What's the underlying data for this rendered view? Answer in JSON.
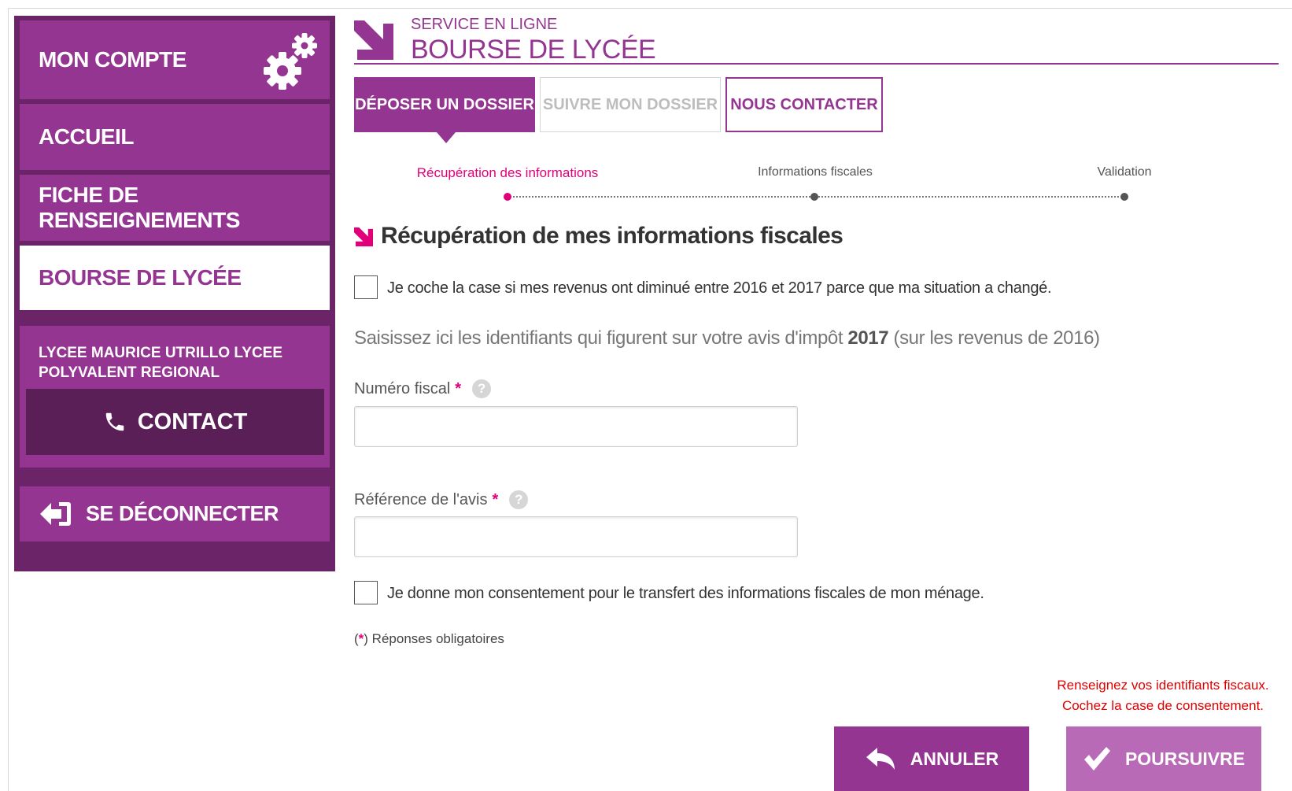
{
  "colors": {
    "brand_purple": "#943592",
    "brand_purple_dark": "#6b2468",
    "accent_pink": "#e2007a",
    "error_red": "#e00000",
    "poursuivre_disabled": "#b96ab7"
  },
  "sidebar": {
    "mon_compte": "MON COMPTE",
    "accueil": "ACCUEIL",
    "fiche": "FICHE DE RENSEIGNEMENTS",
    "bourse": "BOURSE DE LYCÉE",
    "school": "LYCEE MAURICE UTRILLO LYCEE POLYVALENT REGIONAL",
    "contact": "CONTACT",
    "logout": "SE DÉCONNECTER",
    "icons": [
      "gears-icon",
      "phone-icon",
      "logout-icon"
    ]
  },
  "header": {
    "subtitle": "SERVICE EN LIGNE",
    "title": "BOURSE DE LYCÉE"
  },
  "tabs": [
    {
      "label": "DÉPOSER UN DOSSIER",
      "state": "active"
    },
    {
      "label": "SUIVRE MON DOSSIER",
      "state": "disabled"
    },
    {
      "label": "NOUS CONTACTER",
      "state": "default"
    }
  ],
  "steps": [
    {
      "label": "Récupération des informations",
      "state": "current"
    },
    {
      "label": "Informations fiscales",
      "state": "pending"
    },
    {
      "label": "Validation",
      "state": "pending"
    }
  ],
  "section": {
    "title": "Récupération de mes informations fiscales"
  },
  "form": {
    "revenus_checkbox": "Je coche la case si mes revenus ont diminué entre 2016 et 2017 parce que ma situation a changé.",
    "intro_before": "Saisissez ici les identifiants qui figurent sur votre avis d'impôt ",
    "intro_year": "2017",
    "intro_after": " (sur les revenus de 2016)",
    "numero_fiscal_label": "Numéro fiscal",
    "numero_fiscal_value": "",
    "reference_label": "Référence de l'avis",
    "reference_value": "",
    "required_mark": "*",
    "help_glyph": "?",
    "consent_checkbox": "Je donne mon consentement pour le transfert des informations fiscales de mon ménage.",
    "mandatory_open": "(",
    "mandatory_close": ") Réponses obligatoires"
  },
  "errors": [
    "Renseignez vos identifiants fiscaux.",
    "Cochez la case de consentement."
  ],
  "actions": {
    "annuler": "ANNULER",
    "poursuivre": "POURSUIVRE"
  }
}
